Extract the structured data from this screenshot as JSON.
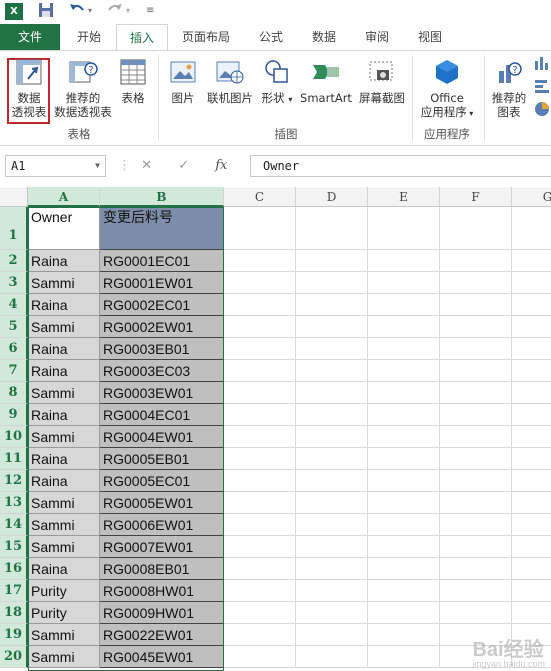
{
  "app": {
    "logo": "X",
    "qat_icons": [
      "save-icon",
      "undo-icon",
      "redo-icon",
      "customize-icon"
    ]
  },
  "tabs": [
    "文件",
    "开始",
    "插入",
    "页面布局",
    "公式",
    "数据",
    "审阅",
    "视图"
  ],
  "active_tab": "插入",
  "ribbon": {
    "pivot_table": [
      "数据",
      "透视表"
    ],
    "recommended_pivot": [
      "推荐的",
      "数据透视表"
    ],
    "table": "表格",
    "group_tables": "表格",
    "picture": "图片",
    "online_picture": "联机图片",
    "shapes": "形状",
    "smartart": "SmartArt",
    "screenshot": "屏幕截图",
    "group_illustrations": "插图",
    "office_apps": [
      "Office",
      "应用程序"
    ],
    "group_apps": "应用程序",
    "recommended_charts": [
      "推荐的",
      "图表"
    ]
  },
  "formula_bar": {
    "name_box": "A1",
    "cancel": "✕",
    "enter": "✓",
    "fx": "fx",
    "value": "Owner"
  },
  "columns": [
    "A",
    "B",
    "C",
    "D",
    "E",
    "F",
    "G"
  ],
  "rows": [
    {
      "n": "1",
      "a": "Owner",
      "b": "变更后料号"
    },
    {
      "n": "2",
      "a": "Raina",
      "b": "RG0001EC01"
    },
    {
      "n": "3",
      "a": "Sammi",
      "b": "RG0001EW01"
    },
    {
      "n": "4",
      "a": "Raina",
      "b": "RG0002EC01"
    },
    {
      "n": "5",
      "a": "Sammi",
      "b": "RG0002EW01"
    },
    {
      "n": "6",
      "a": "Raina",
      "b": "RG0003EB01"
    },
    {
      "n": "7",
      "a": "Raina",
      "b": "RG0003EC03"
    },
    {
      "n": "8",
      "a": "Sammi",
      "b": "RG0003EW01"
    },
    {
      "n": "9",
      "a": "Raina",
      "b": "RG0004EC01"
    },
    {
      "n": "10",
      "a": "Sammi",
      "b": "RG0004EW01"
    },
    {
      "n": "11",
      "a": "Raina",
      "b": "RG0005EB01"
    },
    {
      "n": "12",
      "a": "Raina",
      "b": "RG0005EC01"
    },
    {
      "n": "13",
      "a": "Sammi",
      "b": "RG0005EW01"
    },
    {
      "n": "14",
      "a": "Sammi",
      "b": "RG0006EW01"
    },
    {
      "n": "15",
      "a": "Sammi",
      "b": "RG0007EW01"
    },
    {
      "n": "16",
      "a": "Raina",
      "b": "RG0008EB01"
    },
    {
      "n": "17",
      "a": "Purity",
      "b": "RG0008HW01"
    },
    {
      "n": "18",
      "a": "Purity",
      "b": "RG0009HW01"
    },
    {
      "n": "19",
      "a": "Sammi",
      "b": "RG0022EW01"
    },
    {
      "n": "20",
      "a": "Sammi",
      "b": "RG0045EW01"
    }
  ],
  "watermark": {
    "main": "Bai经验",
    "sub": "jingyan.baidu.com"
  }
}
